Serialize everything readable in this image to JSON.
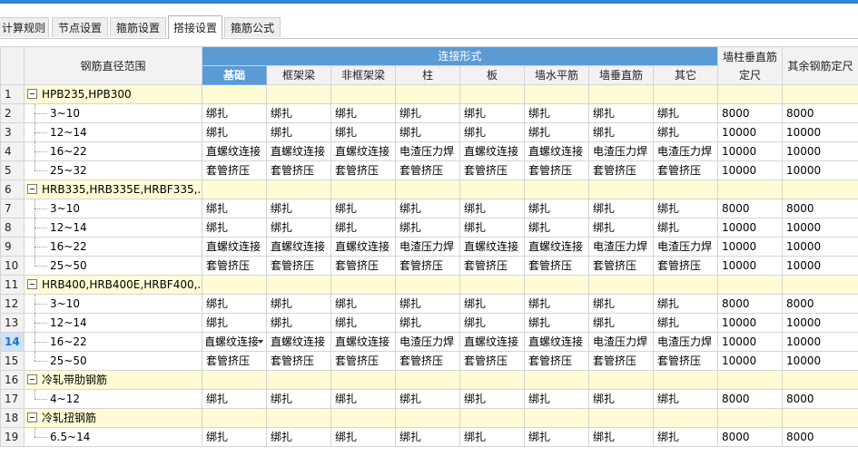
{
  "tabs": [
    {
      "label": "计算规则",
      "active": false
    },
    {
      "label": "节点设置",
      "active": false
    },
    {
      "label": "箍筋设置",
      "active": false
    },
    {
      "label": "搭接设置",
      "active": true
    },
    {
      "label": "箍筋公式",
      "active": false
    }
  ],
  "header": {
    "range": "钢筋直径范围",
    "connection_group": "连接形式",
    "columns": [
      "基础",
      "框架梁",
      "非框架梁",
      "柱",
      "板",
      "墙水平筋",
      "墙垂直筋",
      "其它"
    ],
    "wall_vertical_length": "墙柱垂直筋定尺",
    "other_length": "其余钢筋定尺"
  },
  "rows": [
    {
      "num": "1",
      "type": "group",
      "label": "HPB235,HPB300"
    },
    {
      "num": "2",
      "type": "item",
      "label": "3~10",
      "cells": [
        "绑扎",
        "绑扎",
        "绑扎",
        "绑扎",
        "绑扎",
        "绑扎",
        "绑扎",
        "绑扎"
      ],
      "len1": "8000",
      "len2": "8000"
    },
    {
      "num": "3",
      "type": "item",
      "label": "12~14",
      "cells": [
        "绑扎",
        "绑扎",
        "绑扎",
        "绑扎",
        "绑扎",
        "绑扎",
        "绑扎",
        "绑扎"
      ],
      "len1": "10000",
      "len2": "10000"
    },
    {
      "num": "4",
      "type": "item",
      "label": "16~22",
      "cells": [
        "直螺纹连接",
        "直螺纹连接",
        "直螺纹连接",
        "电渣压力焊",
        "直螺纹连接",
        "直螺纹连接",
        "电渣压力焊",
        "电渣压力焊"
      ],
      "len1": "10000",
      "len2": "10000"
    },
    {
      "num": "5",
      "type": "item",
      "last": true,
      "label": "25~32",
      "cells": [
        "套管挤压",
        "套管挤压",
        "套管挤压",
        "套管挤压",
        "套管挤压",
        "套管挤压",
        "套管挤压",
        "套管挤压"
      ],
      "len1": "10000",
      "len2": "10000"
    },
    {
      "num": "6",
      "type": "group",
      "label": "HRB335,HRB335E,HRBF335,..."
    },
    {
      "num": "7",
      "type": "item",
      "label": "3~10",
      "cells": [
        "绑扎",
        "绑扎",
        "绑扎",
        "绑扎",
        "绑扎",
        "绑扎",
        "绑扎",
        "绑扎"
      ],
      "len1": "8000",
      "len2": "8000"
    },
    {
      "num": "8",
      "type": "item",
      "label": "12~14",
      "cells": [
        "绑扎",
        "绑扎",
        "绑扎",
        "绑扎",
        "绑扎",
        "绑扎",
        "绑扎",
        "绑扎"
      ],
      "len1": "10000",
      "len2": "10000"
    },
    {
      "num": "9",
      "type": "item",
      "label": "16~22",
      "cells": [
        "直螺纹连接",
        "直螺纹连接",
        "直螺纹连接",
        "电渣压力焊",
        "直螺纹连接",
        "直螺纹连接",
        "电渣压力焊",
        "电渣压力焊"
      ],
      "len1": "10000",
      "len2": "10000"
    },
    {
      "num": "10",
      "type": "item",
      "last": true,
      "label": "25~50",
      "cells": [
        "套管挤压",
        "套管挤压",
        "套管挤压",
        "套管挤压",
        "套管挤压",
        "套管挤压",
        "套管挤压",
        "套管挤压"
      ],
      "len1": "10000",
      "len2": "10000"
    },
    {
      "num": "11",
      "type": "group",
      "label": "HRB400,HRB400E,HRBF400,..."
    },
    {
      "num": "12",
      "type": "item",
      "label": "3~10",
      "cells": [
        "绑扎",
        "绑扎",
        "绑扎",
        "绑扎",
        "绑扎",
        "绑扎",
        "绑扎",
        "绑扎"
      ],
      "len1": "8000",
      "len2": "8000"
    },
    {
      "num": "13",
      "type": "item",
      "label": "12~14",
      "cells": [
        "绑扎",
        "绑扎",
        "绑扎",
        "绑扎",
        "绑扎",
        "绑扎",
        "绑扎",
        "绑扎"
      ],
      "len1": "10000",
      "len2": "10000"
    },
    {
      "num": "14",
      "type": "item",
      "selected": true,
      "label": "16~22",
      "cells": [
        "直螺纹连接",
        "直螺纹连接",
        "直螺纹连接",
        "电渣压力焊",
        "直螺纹连接",
        "直螺纹连接",
        "电渣压力焊",
        "电渣压力焊"
      ],
      "len1": "10000",
      "len2": "10000"
    },
    {
      "num": "15",
      "type": "item",
      "last": true,
      "label": "25~50",
      "cells": [
        "套管挤压",
        "套管挤压",
        "套管挤压",
        "套管挤压",
        "套管挤压",
        "套管挤压",
        "套管挤压",
        "套管挤压"
      ],
      "len1": "10000",
      "len2": "10000"
    },
    {
      "num": "16",
      "type": "group",
      "label": "冷轧带肋钢筋"
    },
    {
      "num": "17",
      "type": "item",
      "last": true,
      "label": "4~12",
      "cells": [
        "绑扎",
        "绑扎",
        "绑扎",
        "绑扎",
        "绑扎",
        "绑扎",
        "绑扎",
        "绑扎"
      ],
      "len1": "8000",
      "len2": "8000"
    },
    {
      "num": "18",
      "type": "group",
      "label": "冷轧扭钢筋"
    },
    {
      "num": "19",
      "type": "item",
      "last": true,
      "label": "6.5~14",
      "cells": [
        "绑扎",
        "绑扎",
        "绑扎",
        "绑扎",
        "绑扎",
        "绑扎",
        "绑扎",
        "绑扎"
      ],
      "len1": "8000",
      "len2": "8000"
    }
  ],
  "colors": {
    "accent": "#5b9bd5",
    "group_row": "#fffbd5",
    "header": "#f2f2f2",
    "top_bar": "#2f87d5"
  }
}
